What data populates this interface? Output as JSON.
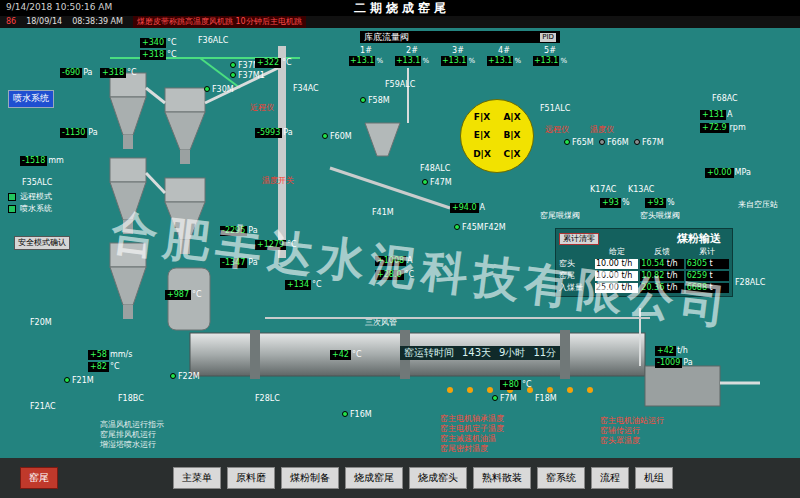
{
  "header": {
    "datetime": "9/14/2018 10:50:16 AM",
    "title": "二 期 烧 成 窑 尾"
  },
  "alarm": {
    "code": "86",
    "date": "18/09/14",
    "time": "08:38:39 AM",
    "message": "煤磨皮带称跳高温度风机跳 10分钟后主电机跳"
  },
  "spray_panel": {
    "title": "喷水系统",
    "modes": [
      {
        "label": "远程模式",
        "on": true
      },
      {
        "label": "喷水系统",
        "on": true
      }
    ],
    "confirm": "安全模式确认"
  },
  "bins": {
    "title": "库底流量阀",
    "mode": "PID",
    "items": [
      {
        "label": "1#",
        "value": "+13.1",
        "unit": "%"
      },
      {
        "label": "2#",
        "value": "+13.1",
        "unit": "%"
      },
      {
        "label": "3#",
        "value": "+13.1",
        "unit": "%"
      },
      {
        "label": "4#",
        "value": "+13.1",
        "unit": "%"
      },
      {
        "label": "5#",
        "value": "+13.1",
        "unit": "%"
      }
    ]
  },
  "dispatcher": {
    "sectors": [
      "F|X",
      "A|X",
      "E|X",
      "B|X",
      "D|X",
      "C|X"
    ]
  },
  "coal": {
    "title": "煤粉输送",
    "reset": "累计清零",
    "columns": [
      "给定",
      "反馈",
      "累计"
    ],
    "rows": [
      {
        "name": "窑头",
        "setpoint": "10.00",
        "feedback": "10.54",
        "total": "6305",
        "rate_unit": "t/h",
        "total_unit": "t"
      },
      {
        "name": "窑尾",
        "setpoint": "10.00",
        "feedback": "10.82",
        "total": "6259",
        "rate_unit": "t/h",
        "total_unit": "t"
      },
      {
        "name": "入煤量",
        "setpoint": "25.00",
        "feedback": "20.36",
        "total": "6688",
        "rate_unit": "t/h",
        "total_unit": "t"
      }
    ]
  },
  "kiln": {
    "runtime_label": "窑运转时间",
    "days": "143天",
    "hours": "9小时",
    "minutes": "11分"
  },
  "tags": [
    "F36ALC",
    "F37M2",
    "F37M1",
    "F30M",
    "F34AC",
    "F59ALC",
    "F58M",
    "F60M",
    "F51ALC",
    "F65M",
    "F66M",
    "F67M",
    "F68AC",
    "F35ALC",
    "F47M",
    "F48ALC",
    "F45M",
    "F42M",
    "F41M",
    "K17AC",
    "K13AC",
    "F7M",
    "F18M",
    "F21M",
    "F21AC",
    "F18BC",
    "F22M",
    "F28LC",
    "F20M",
    "F16M",
    "F28ALC"
  ],
  "readouts": [
    {
      "value": "-690",
      "unit": "Pa"
    },
    {
      "value": "+318",
      "unit": "°C"
    },
    {
      "value": "+340",
      "unit": "°C"
    },
    {
      "value": "+318",
      "unit": "°C"
    },
    {
      "value": "-1518",
      "unit": "mm"
    },
    {
      "value": "+322",
      "unit": "°C"
    },
    {
      "value": "-5993",
      "unit": "Pa"
    },
    {
      "value": "+131",
      "unit": "A"
    },
    {
      "value": "+72.9",
      "unit": "rpm"
    },
    {
      "value": "+0.00",
      "unit": "MPa"
    },
    {
      "value": "+94.0",
      "unit": "A"
    },
    {
      "value": "-2295",
      "unit": "Pa"
    },
    {
      "value": "+1279",
      "unit": "°C"
    },
    {
      "value": "-1347",
      "unit": "Pa"
    },
    {
      "value": "+987",
      "unit": "°C"
    },
    {
      "value": "+134",
      "unit": "°C"
    },
    {
      "value": "+1008",
      "unit": "A"
    },
    {
      "value": "+28.0",
      "unit": "°C"
    },
    {
      "value": "+58",
      "unit": "mm/s"
    },
    {
      "value": "+82",
      "unit": "°C"
    },
    {
      "value": "+42",
      "unit": "°C"
    },
    {
      "value": "+80",
      "unit": "°C"
    },
    {
      "value": "+42",
      "unit": "t/h"
    },
    {
      "value": "-1009",
      "unit": "Pa"
    },
    {
      "value": "+93",
      "unit": "%"
    },
    {
      "value": "+93",
      "unit": "%"
    },
    {
      "value": "-1130",
      "unit": "Pa"
    }
  ],
  "motors": [
    {
      "on": true
    },
    {
      "on": true
    },
    {
      "on": true
    },
    {
      "on": true
    },
    {
      "on": true
    },
    {
      "on": true
    },
    {
      "on": false
    },
    {
      "on": false
    },
    {
      "on": true
    },
    {
      "on": true
    },
    {
      "on": true
    },
    {
      "on": true
    },
    {
      "on": true
    },
    {
      "on": true
    }
  ],
  "labels": [
    {
      "text": "近程仪",
      "kind": "alarm"
    },
    {
      "text": "远程仪",
      "kind": "alarm"
    },
    {
      "text": "温度仪",
      "kind": "alarm"
    },
    {
      "text": "三次风管",
      "kind": "info"
    },
    {
      "text": "来自空压站",
      "kind": "info"
    },
    {
      "text": "窑尾喂煤阀",
      "kind": "info"
    },
    {
      "text": "窑头喂煤阀",
      "kind": "info"
    },
    {
      "text": "温度开关",
      "kind": "alarm"
    }
  ],
  "alarm_lines": [
    "窑主电机轴承温度",
    "窑主电机定子温度",
    "窑主减速机油温",
    "窑尾密封温度"
  ],
  "alarm_lines_right": [
    "窑主电机油站运行",
    "窑辅传运行",
    "窑头罩温度"
  ],
  "status_lines": [
    "高温风机运行指示",
    "窑尾排风机运行",
    "增湿塔喷水运行"
  ],
  "watermark": "合肥丰达水泥科技有限公司",
  "nav": {
    "alarm_button": "窑尾",
    "items": [
      {
        "label": "主菜单",
        "selected": false
      },
      {
        "label": "原料磨",
        "selected": false
      },
      {
        "label": "煤粉制备",
        "selected": false
      },
      {
        "label": "烧成窑尾",
        "selected": false
      },
      {
        "label": "烧成窑头",
        "selected": false
      },
      {
        "label": "熟料散装",
        "selected": false
      },
      {
        "label": "窑系统",
        "selected": false
      },
      {
        "label": "流程",
        "selected": false
      },
      {
        "label": "机组",
        "selected": false
      }
    ]
  }
}
